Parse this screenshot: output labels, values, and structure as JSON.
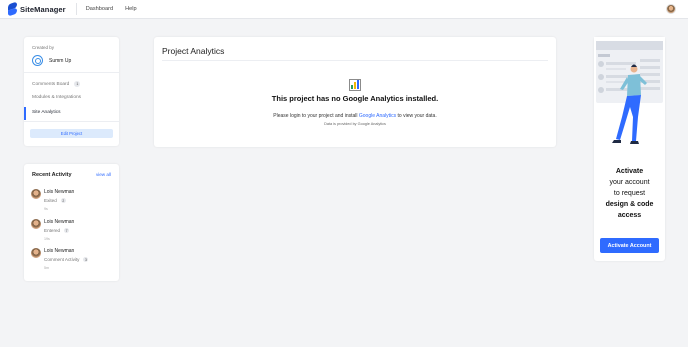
{
  "app": {
    "name": "SiteManager"
  },
  "nav": {
    "items": [
      "Dashboard",
      "Help"
    ]
  },
  "project": {
    "created_by_label": "Created by",
    "creator": "Summ Up",
    "menu": [
      {
        "label": "Comments Board",
        "badge": "1"
      },
      {
        "label": "Modules & Integrations"
      },
      {
        "label": "Site Analytics",
        "active": true
      }
    ],
    "edit_label": "Edit Project"
  },
  "activity": {
    "title": "Recent Activity",
    "view_all": "view all",
    "items": [
      {
        "name": "Lois Newman",
        "action": "Exited",
        "count": "2",
        "time": "9s"
      },
      {
        "name": "Lois Newman",
        "action": "Entered",
        "count": "7",
        "time": "19s"
      },
      {
        "name": "Lois Newman",
        "action": "Comment Activity",
        "count": "3",
        "time": "5m"
      }
    ]
  },
  "analytics": {
    "title": "Project Analytics",
    "heading": "This project has no Google Analytics installed.",
    "sub_prefix": "Please login to your project and install ",
    "sub_link": "Google Analytics",
    "sub_suffix": " to view your data.",
    "note": "Data is provided by Google Analytics"
  },
  "promo": {
    "line1": "Activate",
    "line2": "your account",
    "line3": "to request",
    "line4": "design & code",
    "line5": "access",
    "button": "Activate Account"
  },
  "colors": {
    "accent": "#2f6bff",
    "background": "#f3f4f6"
  }
}
